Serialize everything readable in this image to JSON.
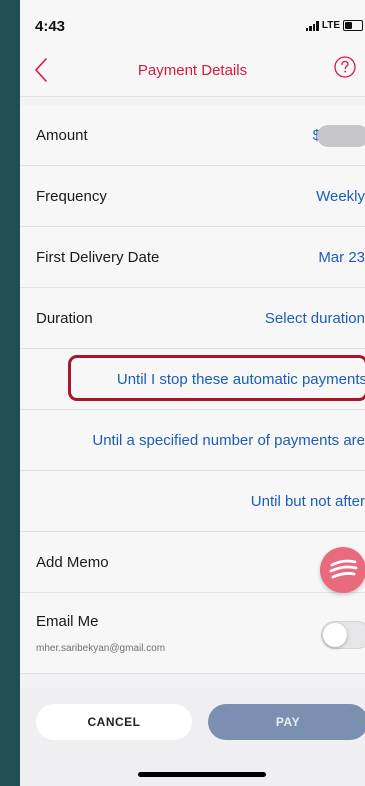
{
  "status": {
    "time": "4:43",
    "network": "LTE"
  },
  "nav": {
    "title": "Payment Details"
  },
  "rows": {
    "amount": {
      "label": "Amount",
      "value": "$"
    },
    "frequency": {
      "label": "Frequency",
      "value": "Weekly"
    },
    "first_delivery": {
      "label": "First Delivery Date",
      "value": "Mar 23"
    },
    "duration": {
      "label": "Duration",
      "value": "Select duration"
    }
  },
  "duration_options": [
    "Until I stop these automatic payments",
    "Until a specified number of payments are",
    "Until but not after"
  ],
  "memo": {
    "label": "Add Memo"
  },
  "email": {
    "label": "Email Me",
    "address": "mher.saribekyan@gmail.com",
    "enabled": false
  },
  "actions": {
    "cancel": "CANCEL",
    "pay": "PAY"
  },
  "colors": {
    "accent_red": "#d7193e",
    "link_blue": "#1c5db8",
    "highlight": "#a7162d",
    "pay_button": "#7b8fb0"
  }
}
